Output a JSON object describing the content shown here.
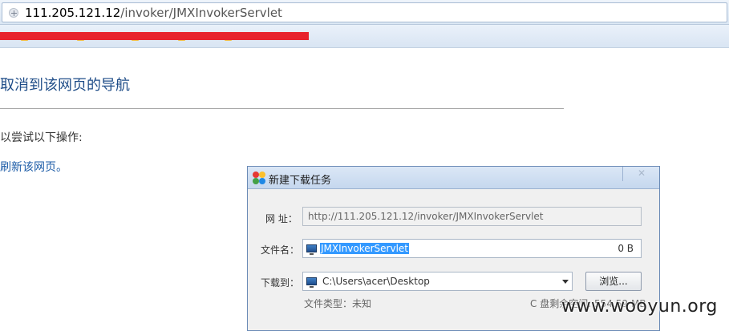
{
  "browser": {
    "url_host": "111.205.121.12",
    "url_path": "/invoker/JMXInvokerServlet"
  },
  "error_page": {
    "title": "取消到该网页的导航",
    "hint": "以尝试以下操作:",
    "refresh_link": "刷新该网页。"
  },
  "dialog": {
    "title": "新建下载任务",
    "url_label": "网  址：",
    "url_value": "http://111.205.121.12/invoker/JMXInvokerServlet",
    "filename_label": "文件名：",
    "filename_value": "JMXInvokerServlet",
    "file_size": "0 B",
    "saveto_label": "下载到：",
    "saveto_value": "C:\\Users\\acer\\Desktop",
    "browse_button": "浏览...",
    "file_type": "文件类型：未知",
    "free_space": "C 盘剩余空间: 554.59 MB"
  },
  "watermark": "www.wooyun.org",
  "colors": {
    "redaction": "#e8242d",
    "selection": "#3399ff",
    "link": "#1a5aa6"
  }
}
